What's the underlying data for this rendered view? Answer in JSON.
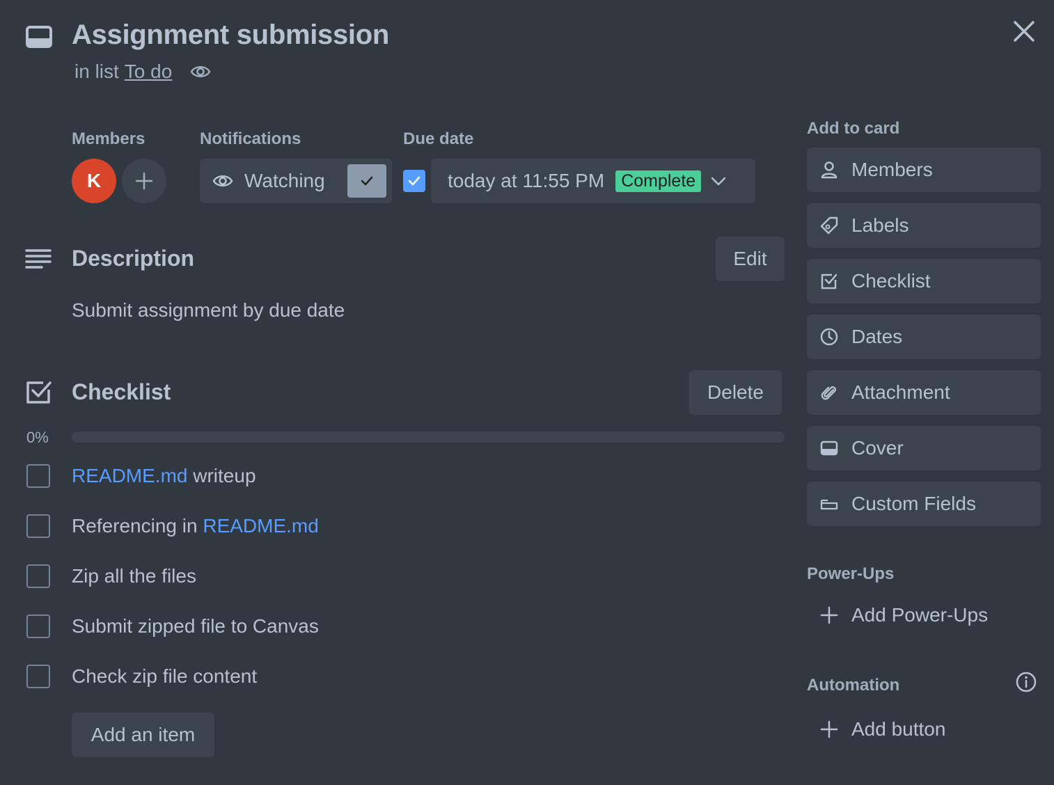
{
  "card": {
    "title": "Assignment submission",
    "in_list_prefix": "in list",
    "list_name": "To do"
  },
  "members": {
    "label": "Members",
    "avatar_initial": "K"
  },
  "notifications": {
    "label": "Notifications",
    "button_label": "Watching",
    "watching": true
  },
  "due_date": {
    "label": "Due date",
    "value": "today at 11:55 PM",
    "status_badge": "Complete",
    "completed": true
  },
  "description": {
    "title": "Description",
    "edit_label": "Edit",
    "text": "Submit assignment by due date"
  },
  "checklist": {
    "title": "Checklist",
    "delete_label": "Delete",
    "progress_label": "0%",
    "progress_fraction": 0,
    "items": [
      {
        "link": "README.md",
        "text": " writeup",
        "checked": false
      },
      {
        "prefix": "Referencing in ",
        "link": "README.md",
        "checked": false
      },
      {
        "text": "Zip all the files",
        "checked": false
      },
      {
        "text": "Submit zipped file to Canvas",
        "checked": false
      },
      {
        "text": "Check zip file content",
        "checked": false
      }
    ],
    "add_item_label": "Add an item"
  },
  "sidebar": {
    "add_to_card_label": "Add to card",
    "buttons": [
      {
        "label": "Members",
        "icon": "person-icon"
      },
      {
        "label": "Labels",
        "icon": "tag-icon"
      },
      {
        "label": "Checklist",
        "icon": "checklist-icon"
      },
      {
        "label": "Dates",
        "icon": "clock-icon"
      },
      {
        "label": "Attachment",
        "icon": "paperclip-icon"
      },
      {
        "label": "Cover",
        "icon": "cover-icon"
      },
      {
        "label": "Custom Fields",
        "icon": "custom-fields-icon"
      }
    ],
    "powerups_label": "Power-Ups",
    "add_powerups_label": "Add Power-Ups",
    "automation_label": "Automation",
    "add_button_label": "Add button"
  },
  "colors": {
    "background": "#323840",
    "button_bg": "#3b434c",
    "text": "#b6c2cf",
    "link": "#579dff",
    "complete_badge": "#4bce97",
    "avatar": "#d9452a"
  }
}
